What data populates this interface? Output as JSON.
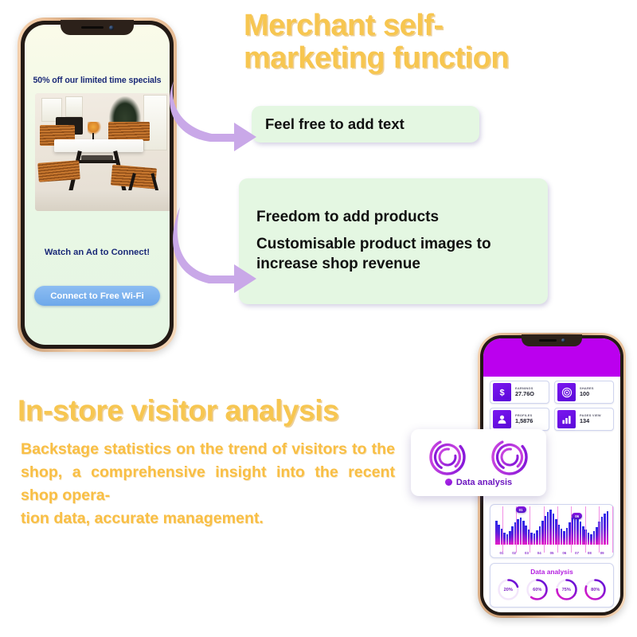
{
  "section1": {
    "heading": "Merchant self-marketing function",
    "callout1": "Feel free to add text",
    "callout2": {
      "line1": "Freedom to add products",
      "line2": "Customisable product images to increase shop revenue"
    }
  },
  "phone1": {
    "promo_headline": "50% off our limited time specials",
    "ad_prompt": "Watch an Ad to Connect!",
    "connect_button": "Connect to Free Wi-Fi",
    "photo_alt": "restaurant-interior-photo"
  },
  "section2": {
    "heading": "In-store visitor analysis",
    "body": "Backstage statistics on the trend of visitors to the shop, a comprehensive insight into the recent shop opera-",
    "body_last": "tion data, accurate management."
  },
  "phone2": {
    "stats": [
      {
        "label": "EARNINGS",
        "value": "27.76O",
        "icon": "dollar-icon"
      },
      {
        "label": "SHARES",
        "value": "100",
        "icon": "target-icon"
      },
      {
        "label": "PROFILES",
        "value": "1,5876",
        "icon": "person-icon"
      },
      {
        "label": "PAGES VIEW",
        "value": "134",
        "icon": "bar-chart-icon"
      }
    ],
    "data_card": {
      "label": "Data analysis",
      "icon": "spiral-ring-icon"
    },
    "bar_chart_badges": [
      "01",
      "06"
    ],
    "donut_panel_title": "Data analysis",
    "donuts": [
      {
        "label": "20%",
        "value": 20
      },
      {
        "label": "60%",
        "value": 60
      },
      {
        "label": "75%",
        "value": 75
      },
      {
        "label": "80%",
        "value": 80
      }
    ]
  },
  "chart_data": {
    "type": "bar",
    "title": "",
    "xlabel": "",
    "ylabel": "",
    "categories": [
      "01",
      "02",
      "03",
      "04",
      "05",
      "06",
      "07",
      "08",
      "09"
    ],
    "tick_labels": [
      "01",
      "02",
      "03",
      "04",
      "05",
      "06",
      "07",
      "08",
      "09"
    ],
    "grid": false,
    "legend": "none",
    "ylim": [
      0,
      100
    ],
    "values": [
      62,
      52,
      40,
      31,
      26,
      34,
      47,
      58,
      66,
      70,
      62,
      50,
      38,
      30,
      28,
      36,
      48,
      62,
      74,
      84,
      90,
      80,
      66,
      52,
      40,
      34,
      44,
      58,
      70,
      78,
      72,
      60,
      48,
      38,
      30,
      26,
      34,
      46,
      60,
      72,
      80,
      86
    ],
    "markers": [
      {
        "label": "01",
        "x_index": 8
      },
      {
        "label": "06",
        "x_index": 27
      }
    ],
    "colors": {
      "bar_top": "#2a28e8",
      "bar_bottom": "#e61cc9",
      "tick": "#f07be0"
    }
  },
  "colors": {
    "heading_yellow": "#f7c650",
    "body_yellow": "#f9bf45",
    "callout_green": "#e4f7e2",
    "arrow_purple": "#c9a8e8",
    "phone2_header": "#bb00ee",
    "promo_navy": "#1b2a78",
    "wifi_blue": "#6da8ea",
    "accent_purple": "#7d1fc4"
  }
}
